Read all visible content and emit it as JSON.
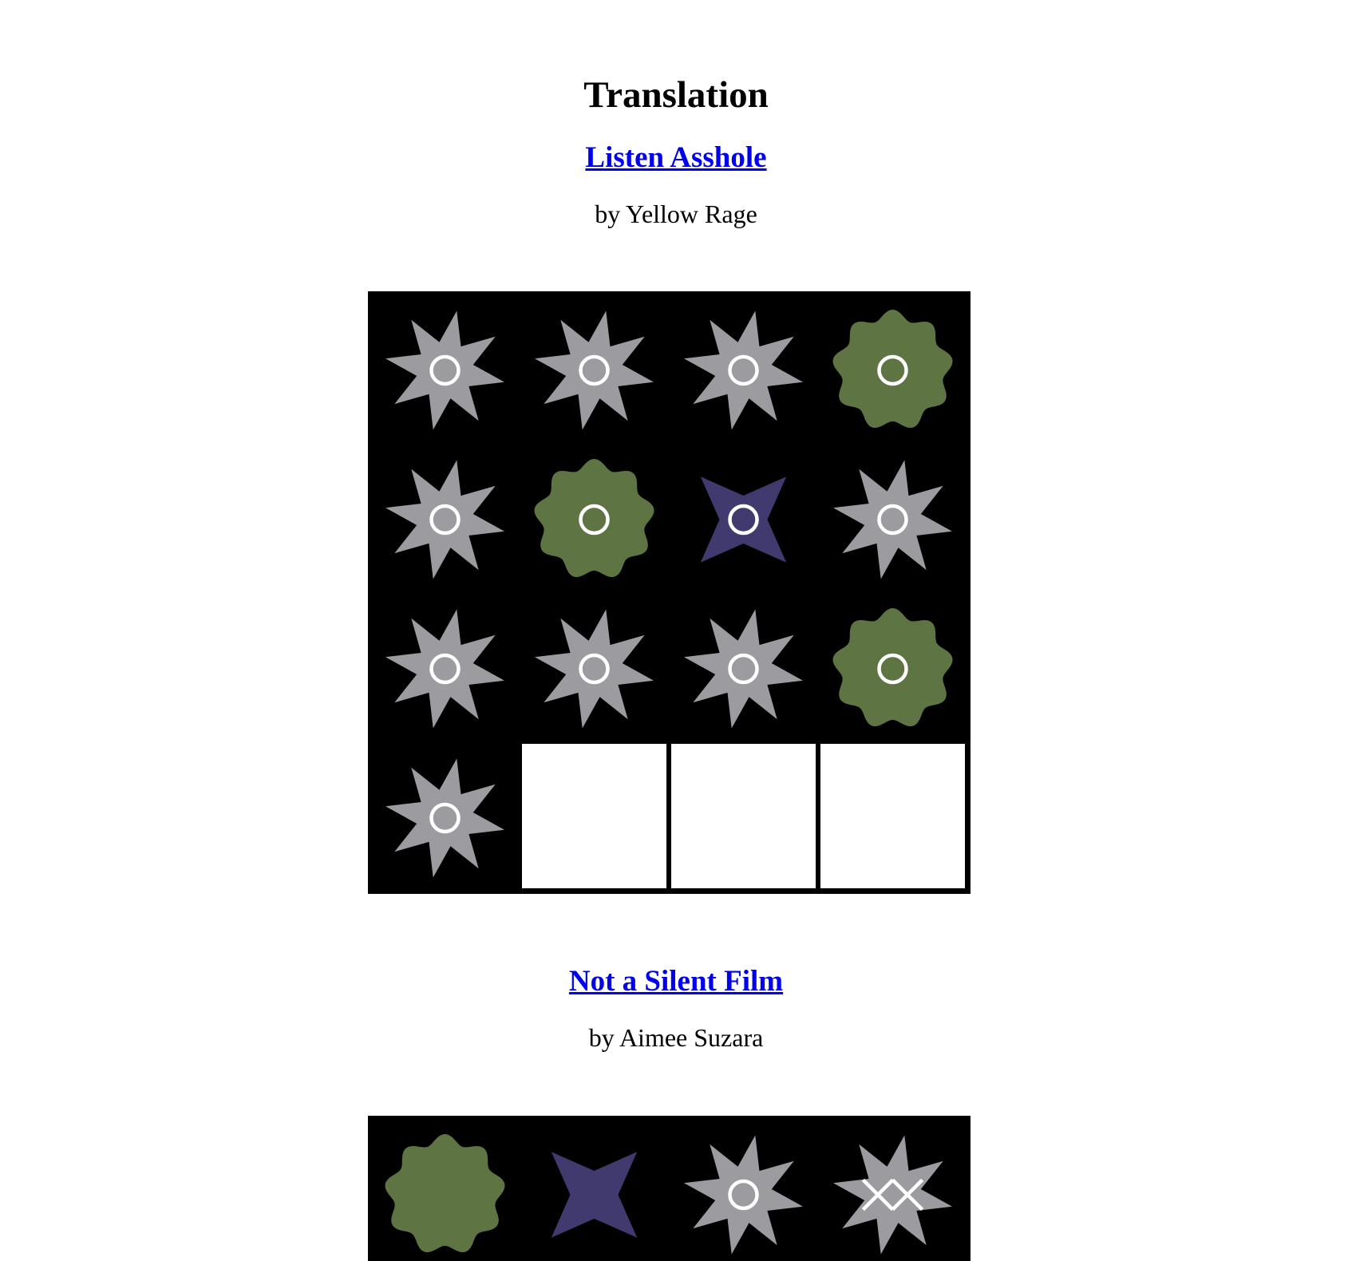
{
  "page": {
    "title": "Translation"
  },
  "colors": {
    "star": "#9b9ba0",
    "flower": "#5e7442",
    "cross": "#413a6e",
    "mark": "#ffffff",
    "grid_bg": "#000000",
    "link": "#0000ee"
  },
  "poems": [
    {
      "title": "Listen Asshole",
      "byline": "by Yellow Rage",
      "tiles": [
        {
          "shape": "star-8",
          "mark": "circle"
        },
        {
          "shape": "star-8",
          "mark": "circle"
        },
        {
          "shape": "star-8",
          "mark": "circle"
        },
        {
          "shape": "flower",
          "mark": "circle"
        },
        {
          "shape": "star-8",
          "mark": "circle"
        },
        {
          "shape": "flower",
          "mark": "circle"
        },
        {
          "shape": "star-4",
          "mark": "circle"
        },
        {
          "shape": "star-8",
          "mark": "circle"
        },
        {
          "shape": "star-8",
          "mark": "circle"
        },
        {
          "shape": "star-8",
          "mark": "circle"
        },
        {
          "shape": "star-8",
          "mark": "circle"
        },
        {
          "shape": "flower",
          "mark": "circle"
        },
        {
          "shape": "star-8",
          "mark": "circle"
        },
        {
          "shape": "empty",
          "mark": "none"
        },
        {
          "shape": "empty",
          "mark": "none"
        },
        {
          "shape": "empty",
          "mark": "none"
        }
      ]
    },
    {
      "title": "Not a Silent Film",
      "byline": "by Aimee Suzara",
      "tiles": [
        {
          "shape": "flower",
          "mark": "none"
        },
        {
          "shape": "star-4",
          "mark": "none"
        },
        {
          "shape": "star-8",
          "mark": "circle"
        },
        {
          "shape": "star-8",
          "mark": "double-x"
        }
      ]
    }
  ]
}
